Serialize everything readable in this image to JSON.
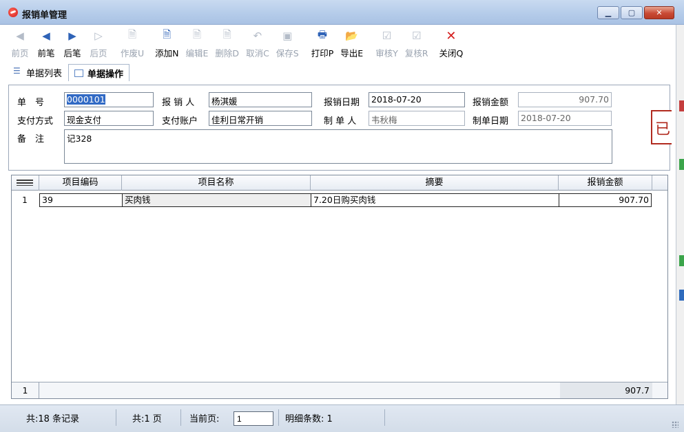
{
  "window": {
    "title": "报销单管理"
  },
  "toolbar": {
    "items": [
      {
        "label": "前页",
        "icon": "double-arrow-left-icon",
        "glyph": "◀",
        "enabled": false
      },
      {
        "label": "前笔",
        "icon": "arrow-left-icon",
        "glyph": "◀",
        "enabled": true
      },
      {
        "label": "后笔",
        "icon": "arrow-right-icon",
        "glyph": "▶",
        "enabled": true
      },
      {
        "label": "后页",
        "icon": "double-arrow-right-icon",
        "glyph": "▷",
        "enabled": false
      },
      {
        "label": "作废U",
        "icon": "void-doc-icon",
        "glyph": "🗎",
        "enabled": false
      },
      {
        "label": "添加N",
        "icon": "add-doc-icon",
        "glyph": "🗎",
        "enabled": true
      },
      {
        "label": "编辑E",
        "icon": "edit-doc-icon",
        "glyph": "🗎",
        "enabled": false
      },
      {
        "label": "删除D",
        "icon": "delete-doc-icon",
        "glyph": "🗎",
        "enabled": false
      },
      {
        "label": "取消C",
        "icon": "undo-icon",
        "glyph": "↶",
        "enabled": false
      },
      {
        "label": "保存S",
        "icon": "save-icon",
        "glyph": "▣",
        "enabled": false
      },
      {
        "label": "打印P",
        "icon": "printer-icon",
        "glyph": "🖶",
        "enabled": true
      },
      {
        "label": "导出E",
        "icon": "export-folder-icon",
        "glyph": "📂",
        "enabled": true
      },
      {
        "label": "审核Y",
        "icon": "approve-check-icon",
        "glyph": "☑",
        "enabled": false
      },
      {
        "label": "复核R",
        "icon": "recheck-icon",
        "glyph": "☑",
        "enabled": false
      },
      {
        "label": "关闭Q",
        "icon": "close-x-icon",
        "glyph": "✕",
        "enabled": true
      }
    ]
  },
  "tabs": [
    {
      "label": "单据列表",
      "active": false
    },
    {
      "label": "单据操作",
      "active": true
    }
  ],
  "form": {
    "doc_no_label": "单　号",
    "doc_no": "0000101",
    "claimant_label": "报 销 人",
    "claimant": "杨淇媛",
    "claim_date_label": "报销日期",
    "claim_date": "2018-07-20",
    "amount_label": "报销金额",
    "amount": "907.70",
    "pay_method_label": "支付方式",
    "pay_method": "现金支付",
    "pay_account_label": "支付账户",
    "pay_account": "佳利日常开销",
    "maker_label": "制 单 人",
    "maker": "韦秋梅",
    "make_date_label": "制单日期",
    "make_date": "2018-07-20",
    "remark_label": "备　注",
    "remark": "记328",
    "stamp": "已"
  },
  "grid": {
    "columns": [
      "项目编码",
      "项目名称",
      "摘要",
      "报销金额"
    ],
    "rows": [
      {
        "no": "1",
        "code": "39",
        "name": "买肉钱",
        "summary": "7.20日购买肉钱",
        "amount": "907.70"
      }
    ],
    "footer": {
      "count": "1",
      "total": "907.7"
    }
  },
  "status": {
    "records": "共:18 条记录",
    "pages": "共:1 页",
    "current_page_label": "当前页:",
    "current_page": "1",
    "detail_count": "明细条数: 1"
  },
  "colors": {
    "titlebar": "#b4cbe9",
    "close_button": "#c94a35",
    "selection": "#316ac5",
    "stamp": "#b12a1e"
  }
}
